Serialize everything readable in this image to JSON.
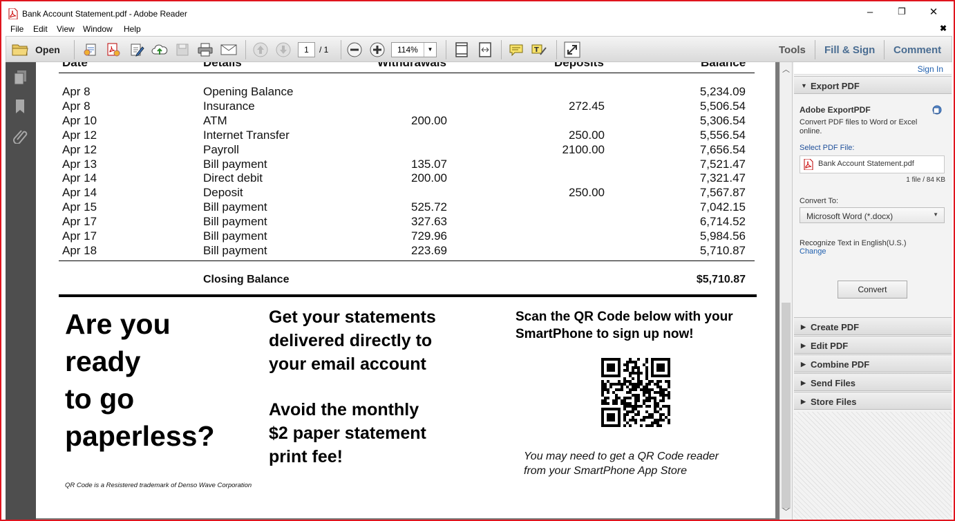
{
  "window": {
    "title": "Bank Account Statement.pdf - Adobe Reader",
    "controls": {
      "minimize": "–",
      "maximize": "❐",
      "close": "✕"
    }
  },
  "menu": {
    "items": [
      "File",
      "Edit",
      "View",
      "Window",
      "Help"
    ],
    "close_doc": "✖"
  },
  "toolbar": {
    "open_label": "Open",
    "page_current": "1",
    "page_total": "/ 1",
    "zoom": "114%",
    "right_links": {
      "tools": "Tools",
      "fill_sign": "Fill & Sign",
      "comment": "Comment"
    }
  },
  "statement": {
    "headers": {
      "date": "Date",
      "details": "Details",
      "withdrawals": "Withdrawals",
      "deposits": "Deposits",
      "balance": "Balance"
    },
    "rows": [
      {
        "date": "Apr 8",
        "details": "Opening Balance",
        "withdrawal": "",
        "deposit": "",
        "balance": "5,234.09"
      },
      {
        "date": "Apr 8",
        "details": "Insurance",
        "withdrawal": "",
        "deposit": "272.45",
        "balance": "5,506.54"
      },
      {
        "date": "Apr 10",
        "details": "ATM",
        "withdrawal": "200.00",
        "deposit": "",
        "balance": "5,306.54"
      },
      {
        "date": "Apr 12",
        "details": "Internet Transfer",
        "withdrawal": "",
        "deposit": "250.00",
        "balance": "5,556.54"
      },
      {
        "date": "Apr 12",
        "details": "Payroll",
        "withdrawal": "",
        "deposit": "2100.00",
        "balance": "7,656.54"
      },
      {
        "date": "Apr 13",
        "details": "Bill payment",
        "withdrawal": "135.07",
        "deposit": "",
        "balance": "7,521.47"
      },
      {
        "date": "Apr 14",
        "details": "Direct debit",
        "withdrawal": "200.00",
        "deposit": "",
        "balance": "7,321.47"
      },
      {
        "date": "Apr 14",
        "details": "Deposit",
        "withdrawal": "",
        "deposit": "250.00",
        "balance": "7,567.87"
      },
      {
        "date": "Apr 15",
        "details": "Bill payment",
        "withdrawal": "525.72",
        "deposit": "",
        "balance": "7,042.15"
      },
      {
        "date": "Apr 17",
        "details": "Bill payment",
        "withdrawal": "327.63",
        "deposit": "",
        "balance": "6,714.52"
      },
      {
        "date": "Apr 17",
        "details": "Bill payment",
        "withdrawal": "729.96",
        "deposit": "",
        "balance": "5,984.56"
      },
      {
        "date": "Apr 18",
        "details": "Bill payment",
        "withdrawal": "223.69",
        "deposit": "",
        "balance": "5,710.87"
      }
    ],
    "closing_label": "Closing Balance",
    "closing_value": "$5,710.87"
  },
  "ad": {
    "paperless_lines": [
      "Are you",
      "ready",
      "to go",
      "paperless?"
    ],
    "statements_lines": [
      "Get your statements",
      "delivered directly to",
      "your email account"
    ],
    "fee_lines": [
      "Avoid the monthly",
      "$2 paper statement",
      "print fee!"
    ],
    "qr_heading_lines": [
      "Scan the QR Code below with your",
      "SmartPhone to sign up now!"
    ],
    "qr_note_lines": [
      "You may need to get a QR Code reader",
      "from your SmartPhone App Store"
    ],
    "trademark": "QR Code is a Resistered trademark of Denso Wave Corporation"
  },
  "panel": {
    "sign_in": "Sign In",
    "export_header": "Export PDF",
    "service_title": "Adobe ExportPDF",
    "service_desc_lines": [
      "Convert PDF files to Word or Excel",
      "online."
    ],
    "select_label": "Select PDF File:",
    "file_name": "Bank Account Statement.pdf",
    "file_info": "1 file / 84 KB",
    "convert_to_label": "Convert To:",
    "convert_to_value": "Microsoft Word (*.docx)",
    "recognize_text": "Recognize Text in English(U.S.)",
    "change_link": "Change",
    "convert_button": "Convert",
    "sections": [
      "Create PDF",
      "Edit PDF",
      "Combine PDF",
      "Send Files",
      "Store Files"
    ]
  },
  "colors": {
    "accent_link": "#1f5fae",
    "panel_link": "#4a6d92",
    "border_red": "#e0141e"
  }
}
